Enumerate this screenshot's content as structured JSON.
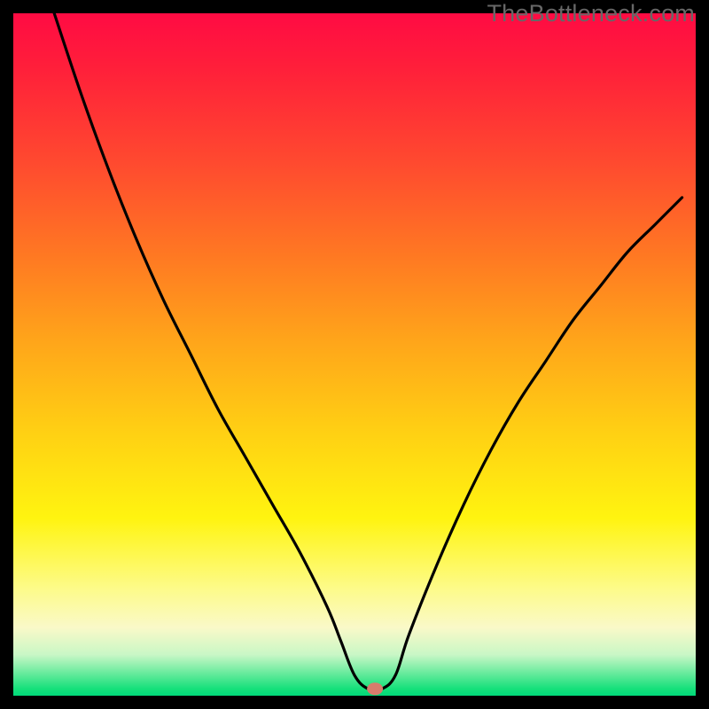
{
  "watermark": "TheBottleneck.com",
  "chart_data": {
    "type": "line",
    "title": "",
    "xlabel": "",
    "ylabel": "",
    "xlim": [
      0,
      100
    ],
    "ylim": [
      0,
      100
    ],
    "series": [
      {
        "name": "curve",
        "x": [
          6,
          10,
          14,
          18,
          22,
          26,
          30,
          34,
          38,
          42,
          46,
          48,
          50,
          52,
          54,
          56,
          58,
          62,
          66,
          70,
          74,
          78,
          82,
          86,
          90,
          94,
          98
        ],
        "values": [
          100,
          88,
          77,
          67,
          58,
          50,
          42,
          35,
          28,
          21,
          13,
          8,
          3,
          1,
          1,
          3,
          9,
          19,
          28,
          36,
          43,
          49,
          55,
          60,
          65,
          69,
          73
        ]
      }
    ],
    "marker": {
      "x": 53,
      "y": 1,
      "color": "#d87c6c"
    },
    "background_gradient": {
      "top": "#ff0b43",
      "mid": "#ffd213",
      "bottom": "#00d97a"
    }
  }
}
